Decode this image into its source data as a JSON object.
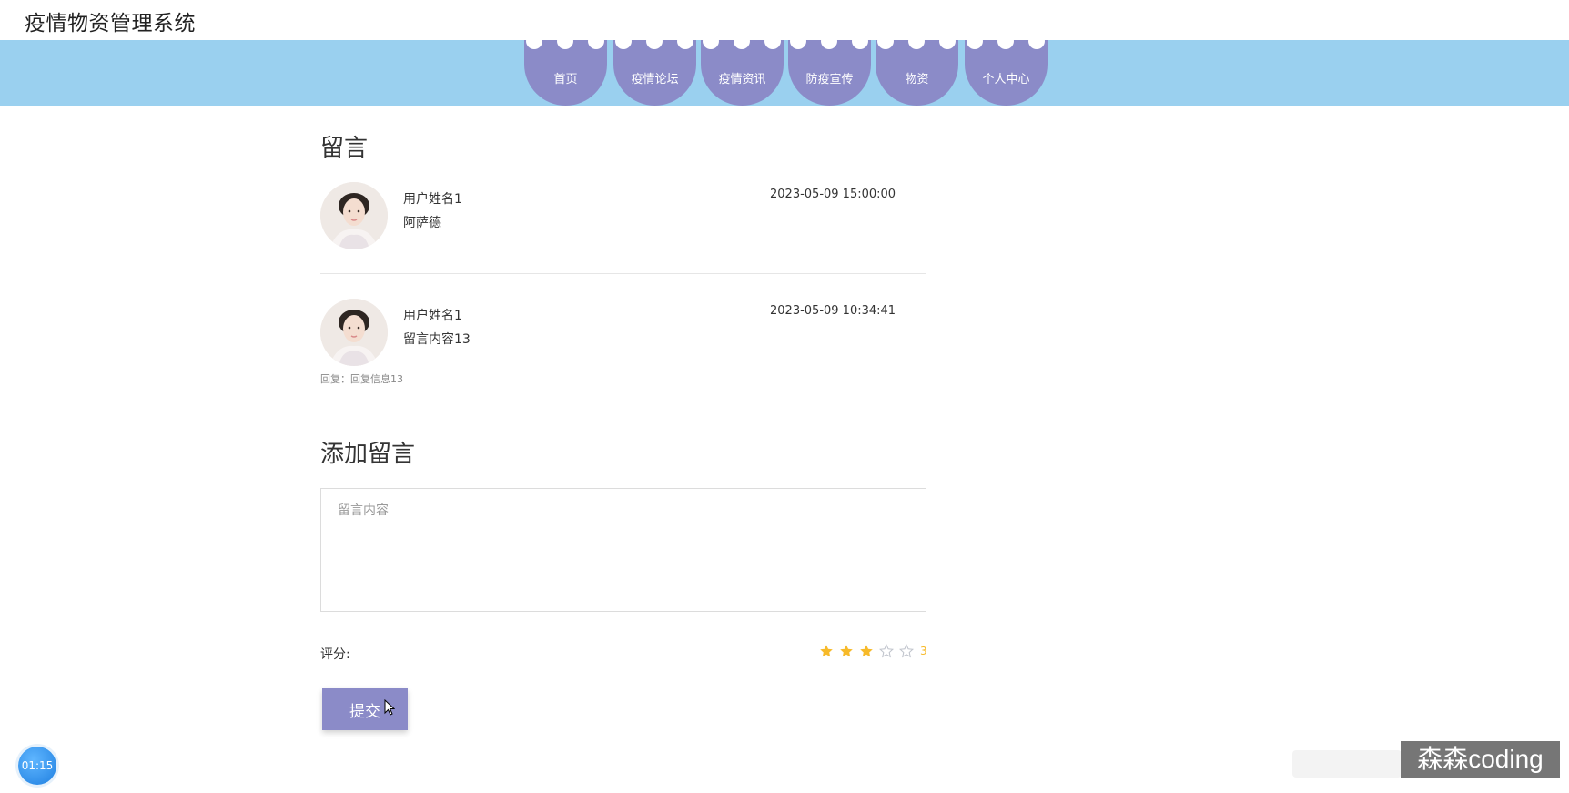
{
  "app": {
    "title": "疫情物资管理系统"
  },
  "nav": {
    "items": [
      {
        "label": "首页"
      },
      {
        "label": "疫情论坛"
      },
      {
        "label": "疫情资讯"
      },
      {
        "label": "防疫宣传"
      },
      {
        "label": "物资"
      },
      {
        "label": "个人中心"
      }
    ]
  },
  "messages": {
    "heading": "留言",
    "list": [
      {
        "user": "用户姓名1",
        "content": "阿萨德",
        "time": "2023-05-09 15:00:00",
        "reply": ""
      },
      {
        "user": "用户姓名1",
        "content": "留言内容13",
        "time": "2023-05-09 10:34:41",
        "reply": "回复：回复信息13"
      }
    ]
  },
  "add_message": {
    "heading": "添加留言",
    "placeholder": "留言内容",
    "rating_label": "评分:",
    "rating_value": 3,
    "rating_max": 5,
    "rating_text": "3",
    "submit_label": "提交"
  },
  "overlay": {
    "timer": "01:15",
    "watermark": "森森coding"
  },
  "colors": {
    "nav_band": "#9ad0ef",
    "nav_item": "#8b8bc8",
    "star_on": "#f7ba2a",
    "star_off": "#c0c4cc",
    "submit": "#8b8bc8"
  }
}
